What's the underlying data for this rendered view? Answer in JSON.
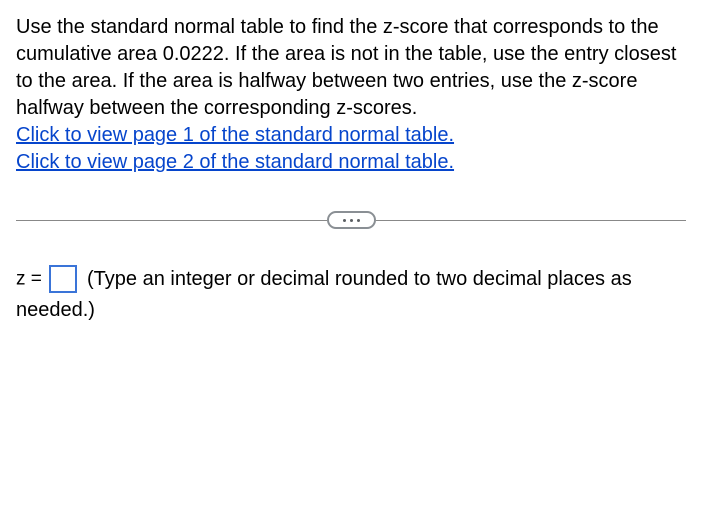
{
  "question": {
    "text": "Use the standard normal table to find the z-score that corresponds to the cumulative area 0.0222. If the area is not in the table, use the entry closest to the area. If the area is halfway between two entries, use the z-score halfway between the corresponding z-scores.",
    "link1": "Click to view page 1 of the standard normal table.",
    "link2": "Click to view page 2 of the standard normal table."
  },
  "answer": {
    "label": "z =",
    "value": "",
    "hint": "(Type an integer or decimal rounded to two decimal places as needed.)"
  }
}
